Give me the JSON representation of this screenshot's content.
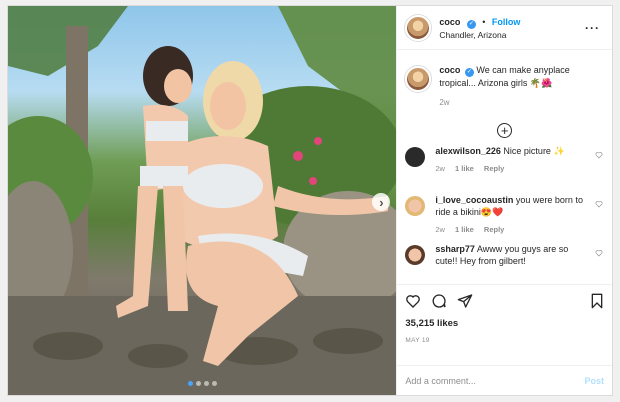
{
  "header": {
    "username": "coco",
    "separator": "•",
    "follow_label": "Follow",
    "location": "Chandler, Arizona",
    "more_icon": "ellipsis-icon"
  },
  "caption": {
    "username": "coco",
    "text": "We can make anyplace tropical... Arizona girls 🌴🌺",
    "time": "2w"
  },
  "load_more_icon": "plus-circle-icon",
  "comments": [
    {
      "username": "alexwilson_226",
      "text": "Nice picture ✨",
      "time": "2w",
      "likes": "1 like",
      "reply": "Reply"
    },
    {
      "username": "i_love_cocoaustin",
      "text": "you were born to ride a bikini😍❤️",
      "time": "2w",
      "likes": "1 like",
      "reply": "Reply"
    },
    {
      "username": "ssharp77",
      "text": "Awww you guys are so cute!! Hey from gilbert!",
      "time": "",
      "likes": "",
      "reply": ""
    }
  ],
  "actions": {
    "likes": "35,215 likes",
    "date": "MAY 19"
  },
  "add_comment": {
    "placeholder": "Add a comment...",
    "post_label": "Post"
  },
  "carousel": {
    "next_icon": "chevron-right-icon",
    "dot_count": 4,
    "active_dot": 0
  },
  "colors": {
    "accent": "#0095f6",
    "verified": "#3897f0",
    "muted": "#8e8e8e",
    "post_disabled": "#b2dffc"
  }
}
